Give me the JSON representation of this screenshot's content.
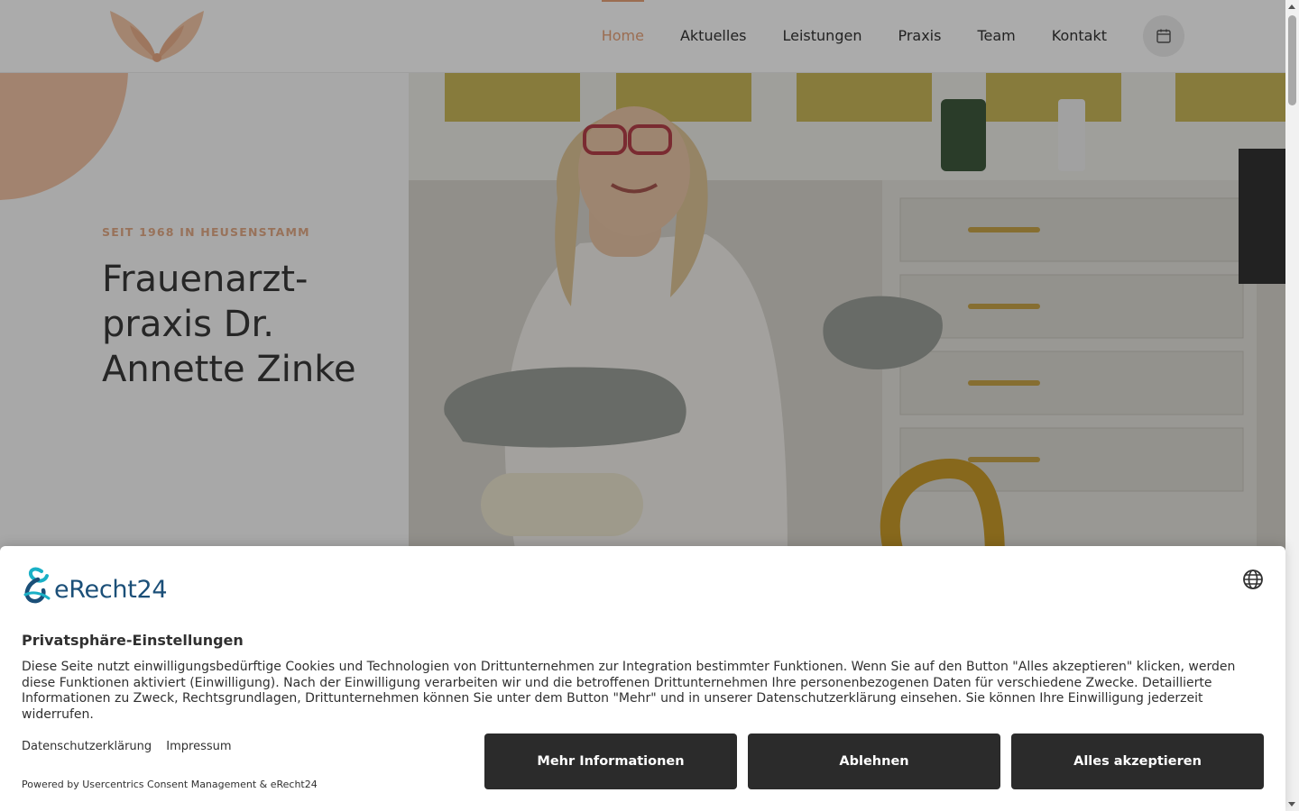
{
  "nav": {
    "items": [
      {
        "label": "Home",
        "active": true
      },
      {
        "label": "Aktuelles"
      },
      {
        "label": "Leistungen"
      },
      {
        "label": "Praxis"
      },
      {
        "label": "Team"
      },
      {
        "label": "Kontakt"
      }
    ],
    "calendar_icon": "calendar-icon",
    "accent_color": "#e8a37a"
  },
  "hero": {
    "eyebrow": "SEIT 1968 IN HEUSENSTAMM",
    "title": "Frauenarzt-praxis Dr. Annette Zinke"
  },
  "consent": {
    "brand": "eRecht24",
    "title": "Privatsphäre-Einstellungen",
    "text": "Diese Seite nutzt einwilligungsbedürftige Cookies und Technologien von Drittunternehmen zur Integration bestimmter Funktionen. Wenn Sie auf den Button \"Alles akzeptieren\" klicken, werden diese Funktionen aktiviert (Einwilligung). Nach der Einwilligung verarbeiten wir und die betroffenen Drittunternehmen Ihre personenbezogenen Daten für verschiedene Zwecke. Detaillierte Informationen zu Zweck, Rechtsgrundlagen, Drittunternehmen können Sie unter dem Button \"Mehr\" und in unserer Datenschutzerklärung einsehen. Sie können Ihre Einwilligung jederzeit widerrufen.",
    "links": {
      "privacy": "Datenschutzerklärung",
      "imprint": "Impressum"
    },
    "powered": "Powered by Usercentrics Consent Management & eRecht24",
    "buttons": {
      "more": "Mehr Informationen",
      "deny": "Ablehnen",
      "accept": "Alles akzeptieren"
    },
    "button_color": "#2b2b2b"
  }
}
